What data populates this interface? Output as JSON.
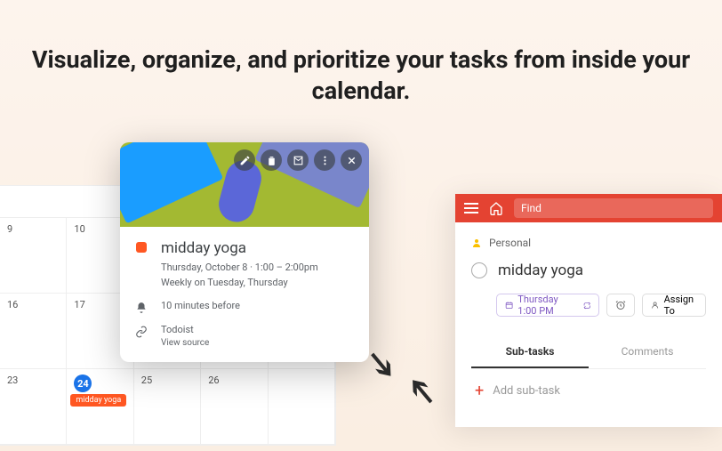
{
  "headline": "Visualize, organize, and prioritize your tasks from inside your calendar.",
  "calendar": {
    "days": [
      "9",
      "10",
      "",
      "",
      "",
      "16",
      "17",
      "",
      "",
      "",
      "23",
      "24",
      "25",
      "26",
      ""
    ],
    "today_index": 11,
    "chip": "midday yoga"
  },
  "popup": {
    "title": "midday yoga",
    "date_line": "Thursday, October 8  ·  1:00 – 2:00pm",
    "recur": "Weekly on Tuesday, Thursday",
    "reminder": "10 minutes before",
    "source": "Todoist",
    "view_source": "View source"
  },
  "todoist": {
    "find": "Find",
    "project": "Personal",
    "task": "midday yoga",
    "date": "Thursday 1:00 PM",
    "assign": "Assign To",
    "tabs": {
      "sub": "Sub-tasks",
      "comments": "Comments"
    },
    "add": "Add sub-task"
  }
}
